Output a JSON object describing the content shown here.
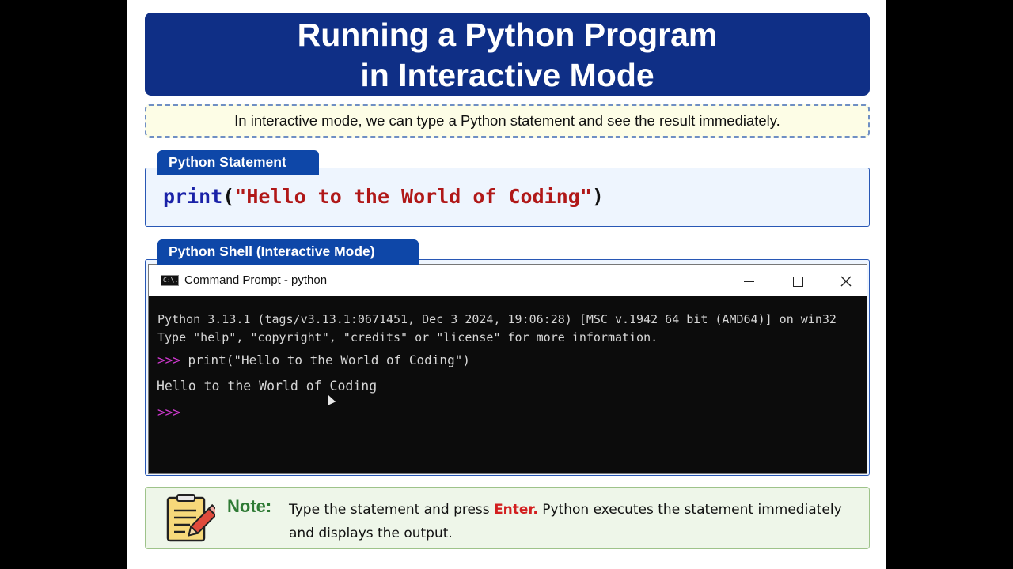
{
  "slide": {
    "title_line1": "Running a Python Program",
    "title_line2": "in Interactive Mode",
    "intro": "In interactive mode, we can type a Python statement and see the result immediately.",
    "statement_tab": "Python Statement",
    "statement_code": {
      "keyword": "print",
      "open": "(",
      "string": "\"Hello to the World of Coding\"",
      "close": ")"
    },
    "shell_tab": "Python Shell (Interactive Mode)"
  },
  "cmd_window": {
    "icon_text": "C:\\.",
    "title": "Command Prompt - python",
    "minimize_icon": "minimize-icon",
    "maximize_icon": "maximize-icon",
    "close_icon": "close-icon",
    "banner_line1": "Python 3.13.1 (tags/v3.13.1:0671451, Dec  3 2024, 19:06:28) [MSC v.1942 64 bit (AMD64)] on win32",
    "banner_line2": "Type \"help\", \"copyright\", \"credits\" or \"license\" for more information.",
    "prompt": ">>>",
    "command": "print(\"Hello to the World of Coding\")",
    "output": "Hello to the World of Coding",
    "prompt_color": "#d23ad2"
  },
  "note": {
    "label": "Note:",
    "text_before": "Type the statement and press ",
    "enter": "Enter.",
    "text_after": " Python executes the statement immediately and displays the output."
  },
  "colors": {
    "title_bg": "#0f2f86",
    "tab_bg": "#0e47a8",
    "keyword": "#1a22a8",
    "string": "#b01818",
    "note_label": "#2e7a34",
    "enter_highlight": "#d21f1f"
  }
}
